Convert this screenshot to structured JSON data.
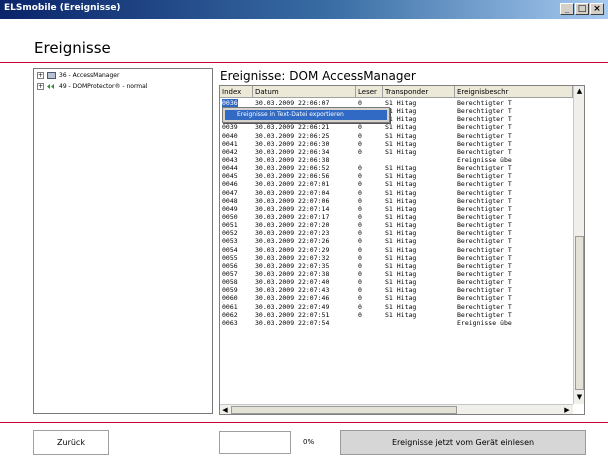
{
  "window": {
    "title": "ELSmobile (Ereignisse)",
    "buttons": {
      "minimize": "_",
      "maximize": "□",
      "close": "×"
    }
  },
  "page": {
    "heading": "Ereignisse"
  },
  "tree": {
    "items": [
      {
        "expander": "+",
        "icon": "access-manager-icon",
        "label": "36 - AccessManager"
      },
      {
        "expander": "+",
        "icon": "dom-protector-icon",
        "label": "49 - DOMProtector® - normal"
      }
    ]
  },
  "events": {
    "title": "Ereignisse: DOM AccessManager",
    "columns": [
      "Index",
      "Datum",
      "Leser",
      "Transponder",
      "Ereignisbeschr"
    ],
    "rows": [
      [
        "0036",
        "30.03.2009  22:06:07",
        "0",
        "S1 Hitag",
        "Berechtigter T"
      ],
      [
        "0037",
        "",
        "",
        "S1 Hitag",
        "Berechtigter T"
      ],
      [
        "0038",
        "",
        "",
        "S1 Hitag",
        "Berechtigter T"
      ],
      [
        "0039",
        "30.03.2009  22:06:21",
        "0",
        "S1 Hitag",
        "Berechtigter T"
      ],
      [
        "0040",
        "30.03.2009  22:06:25",
        "0",
        "S1 Hitag",
        "Berechtigter T"
      ],
      [
        "0041",
        "30.03.2009  22:06:30",
        "0",
        "S1 Hitag",
        "Berechtigter T"
      ],
      [
        "0042",
        "30.03.2009  22:06:34",
        "0",
        "S1 Hitag",
        "Berechtigter T"
      ],
      [
        "0043",
        "30.03.2009  22:06:38",
        "",
        "",
        "Ereignisse übe"
      ],
      [
        "0044",
        "30.03.2009  22:06:52",
        "0",
        "S1 Hitag",
        "Berechtigter T"
      ],
      [
        "0045",
        "30.03.2009  22:06:56",
        "0",
        "S1 Hitag",
        "Berechtigter T"
      ],
      [
        "0046",
        "30.03.2009  22:07:01",
        "0",
        "S1 Hitag",
        "Berechtigter T"
      ],
      [
        "0047",
        "30.03.2009  22:07:04",
        "0",
        "S1 Hitag",
        "Berechtigter T"
      ],
      [
        "0048",
        "30.03.2009  22:07:06",
        "0",
        "S1 Hitag",
        "Berechtigter T"
      ],
      [
        "0049",
        "30.03.2009  22:07:14",
        "0",
        "S1 Hitag",
        "Berechtigter T"
      ],
      [
        "0050",
        "30.03.2009  22:07:17",
        "0",
        "S1 Hitag",
        "Berechtigter T"
      ],
      [
        "0051",
        "30.03.2009  22:07:20",
        "0",
        "S1 Hitag",
        "Berechtigter T"
      ],
      [
        "0052",
        "30.03.2009  22:07:23",
        "0",
        "S1 Hitag",
        "Berechtigter T"
      ],
      [
        "0053",
        "30.03.2009  22:07:26",
        "0",
        "S1 Hitag",
        "Berechtigter T"
      ],
      [
        "0054",
        "30.03.2009  22:07:29",
        "0",
        "S1 Hitag",
        "Berechtigter T"
      ],
      [
        "0055",
        "30.03.2009  22:07:32",
        "0",
        "S1 Hitag",
        "Berechtigter T"
      ],
      [
        "0056",
        "30.03.2009  22:07:35",
        "0",
        "S1 Hitag",
        "Berechtigter T"
      ],
      [
        "0057",
        "30.03.2009  22:07:38",
        "0",
        "S1 Hitag",
        "Berechtigter T"
      ],
      [
        "0058",
        "30.03.2009  22:07:40",
        "0",
        "S1 Hitag",
        "Berechtigter T"
      ],
      [
        "0059",
        "30.03.2009  22:07:43",
        "0",
        "S1 Hitag",
        "Berechtigter T"
      ],
      [
        "0060",
        "30.03.2009  22:07:46",
        "0",
        "S1 Hitag",
        "Berechtigter T"
      ],
      [
        "0061",
        "30.03.2009  22:07:49",
        "0",
        "S1 Hitag",
        "Berechtigter T"
      ],
      [
        "0062",
        "30.03.2009  22:07:51",
        "0",
        "S1 Hitag",
        "Berechtigter T"
      ],
      [
        "0063",
        "30.03.2009  22:07:54",
        "",
        "",
        "Ereignisse übe"
      ]
    ],
    "selected_index": "0036"
  },
  "context_menu": {
    "items": [
      "Ereignisse in Text-Datei exportieren"
    ]
  },
  "footer": {
    "back_label": "Zurück",
    "progress": 0,
    "progress_text": "0%",
    "read_label": "Ereignisse jetzt vom Gerät einlesen"
  },
  "colors": {
    "accent_line": "#c4002e",
    "selection": "#316ac5"
  }
}
